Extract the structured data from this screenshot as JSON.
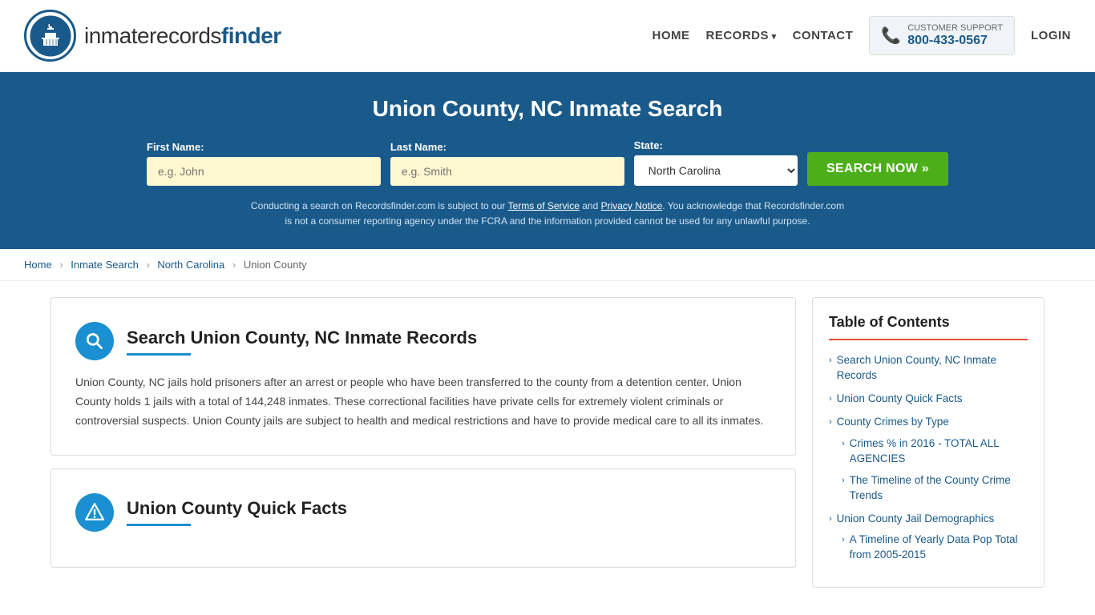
{
  "header": {
    "logo_text_light": "inmaterecords",
    "logo_text_bold": "finder",
    "nav": {
      "home_label": "HOME",
      "records_label": "RECORDS",
      "contact_label": "CONTACT",
      "support_label": "CUSTOMER SUPPORT",
      "support_number": "800-433-0567",
      "login_label": "LOGIN"
    }
  },
  "hero": {
    "title": "Union County, NC Inmate Search",
    "form": {
      "first_name_label": "First Name:",
      "first_name_placeholder": "e.g. John",
      "last_name_label": "Last Name:",
      "last_name_placeholder": "e.g. Smith",
      "state_label": "State:",
      "state_value": "North Carolina",
      "search_button": "SEARCH NOW »"
    },
    "disclaimer": "Conducting a search on Recordsfinder.com is subject to our Terms of Service and Privacy Notice. You acknowledge that Recordsfinder.com is not a consumer reporting agency under the FCRA and the information provided cannot be used for any unlawful purpose."
  },
  "breadcrumb": {
    "items": [
      "Home",
      "Inmate Search",
      "North Carolina",
      "Union County"
    ]
  },
  "main_section": {
    "title": "Search Union County, NC Inmate Records",
    "body": "Union County, NC jails hold prisoners after an arrest or people who have been transferred to the county from a detention center. Union County holds 1 jails with a total of 144,248 inmates. These correctional facilities have private cells for extremely violent criminals or controversial suspects. Union County jails are subject to health and medical restrictions and have to provide medical care to all its inmates."
  },
  "quick_facts_section": {
    "title": "Union County Quick Facts"
  },
  "sidebar": {
    "title": "Table of Contents",
    "items": [
      {
        "label": "Search Union County, NC Inmate Records",
        "href": "#"
      },
      {
        "label": "Union County Quick Facts",
        "href": "#"
      },
      {
        "label": "County Crimes by Type",
        "href": "#"
      },
      {
        "label": "Crimes % in 2016 - TOTAL ALL AGENCIES",
        "href": "#",
        "sub": true
      },
      {
        "label": "The Timeline of the County Crime Trends",
        "href": "#",
        "sub": true
      },
      {
        "label": "Union County Jail Demographics",
        "href": "#"
      },
      {
        "label": "A Timeline of Yearly Data Pop Total from 2005-2015",
        "href": "#",
        "sub": true
      }
    ]
  }
}
